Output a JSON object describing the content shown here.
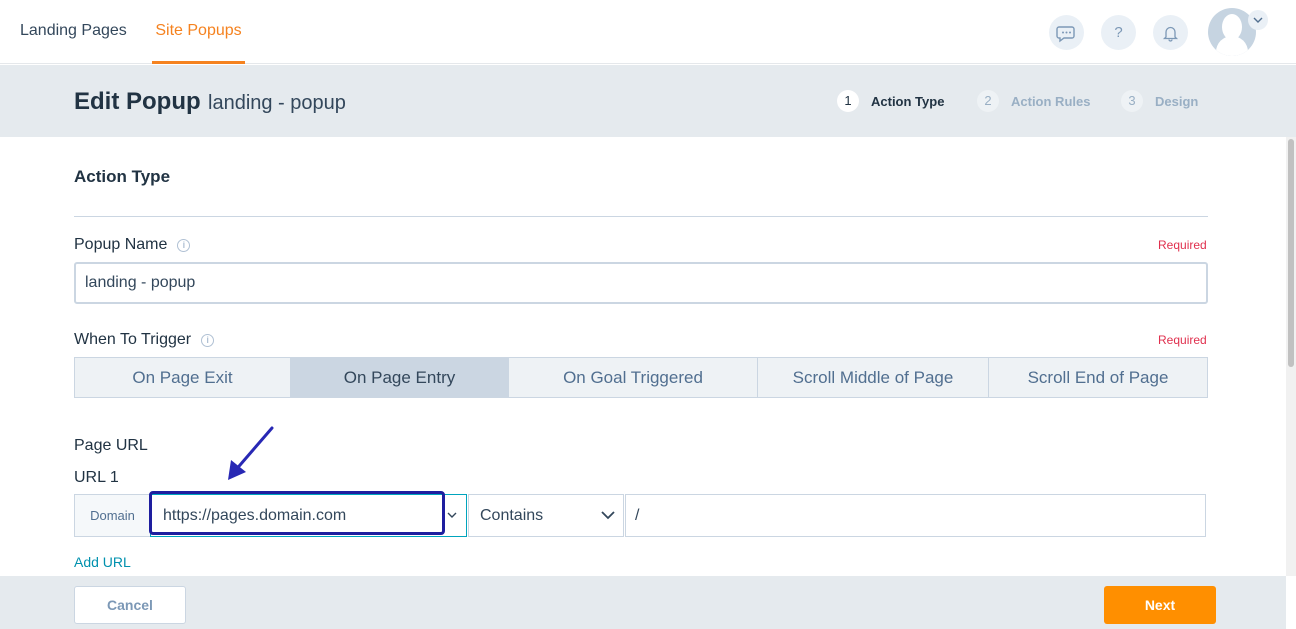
{
  "nav": {
    "tabs": [
      {
        "label": "Landing Pages"
      },
      {
        "label": "Site Popups"
      }
    ],
    "icons": [
      "chat-icon",
      "help-icon",
      "bell-icon"
    ],
    "help_glyph": "?"
  },
  "header": {
    "title": "Edit Popup",
    "subtitle": "landing - popup",
    "steps": [
      {
        "num": "1",
        "label": "Action Type"
      },
      {
        "num": "2",
        "label": "Action Rules"
      },
      {
        "num": "3",
        "label": "Design"
      }
    ]
  },
  "main": {
    "section_title": "Action Type",
    "popup_name": {
      "label": "Popup Name",
      "required": "Required",
      "value": "landing - popup"
    },
    "trigger": {
      "label": "When To Trigger",
      "required": "Required",
      "options": [
        {
          "label": "On Page Exit"
        },
        {
          "label": "On Page Entry"
        },
        {
          "label": "On Goal Triggered"
        },
        {
          "label": "Scroll Middle of Page"
        },
        {
          "label": "Scroll End of Page"
        }
      ],
      "selected": "On Page Entry"
    },
    "page_url": {
      "label": "Page URL",
      "url_label": "URL 1",
      "domain_tag": "Domain",
      "domain_value": "https://pages.domain.com",
      "match_value": "Contains",
      "path_value": "/",
      "add_url": "Add URL"
    }
  },
  "footer": {
    "cancel": "Cancel",
    "next": "Next"
  },
  "colors": {
    "accent": "#f5821f",
    "next_button": "#ff8f00",
    "annotation": "#1e1e9f",
    "required": "#e0304e",
    "link": "#0091ae"
  }
}
